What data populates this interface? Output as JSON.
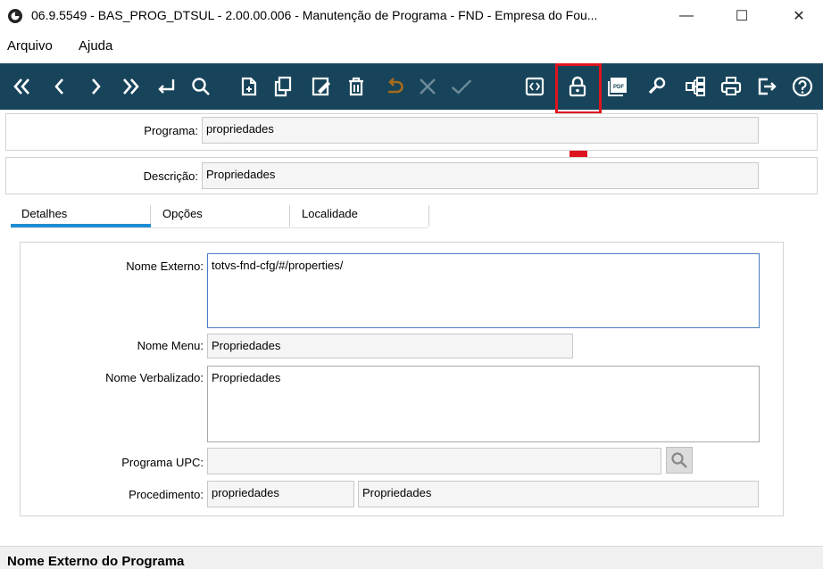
{
  "window": {
    "title": "06.9.5549 - BAS_PROG_DTSUL - 2.00.00.006 - Manutenção de Programa - FND - Empresa do Fou...",
    "minimize": "—",
    "maximize": "☐",
    "close": "✕"
  },
  "menu": {
    "arquivo": "Arquivo",
    "ajuda": "Ajuda"
  },
  "toolbar": {
    "icons": [
      "first-record-icon",
      "previous-record-icon",
      "next-record-icon",
      "last-record-icon",
      "goto-icon",
      "search-icon",
      "new-record-icon",
      "copy-record-icon",
      "edit-record-icon",
      "delete-record-icon",
      "undo-icon",
      "cancel-icon",
      "confirm-icon",
      "code-icon",
      "lock-icon",
      "pdf-icon",
      "settings-icon",
      "structure-icon",
      "print-icon",
      "exit-icon",
      "help-icon"
    ],
    "accent": "#17445a",
    "highlight_color": "#e0141e"
  },
  "header": {
    "programa_label": "Programa:",
    "programa_value": "propriedades",
    "descricao_label": "Descrição:",
    "descricao_value": "Propriedades"
  },
  "tabs": {
    "detalhes": "Detalhes",
    "opcoes": "Opções",
    "localidade": "Localidade"
  },
  "details": {
    "nome_externo_label": "Nome Externo:",
    "nome_externo_value": "totvs-fnd-cfg/#/properties/",
    "nome_menu_label": "Nome Menu:",
    "nome_menu_value": "Propriedades",
    "nome_verbalizado_label": "Nome Verbalizado:",
    "nome_verbalizado_value": "Propriedades",
    "programa_upc_label": "Programa UPC:",
    "programa_upc_value": "",
    "procedimento_label": "Procedimento:",
    "procedimento_code": "propriedades",
    "procedimento_desc": "Propriedades"
  },
  "status": {
    "text": "Nome Externo do Programa"
  }
}
